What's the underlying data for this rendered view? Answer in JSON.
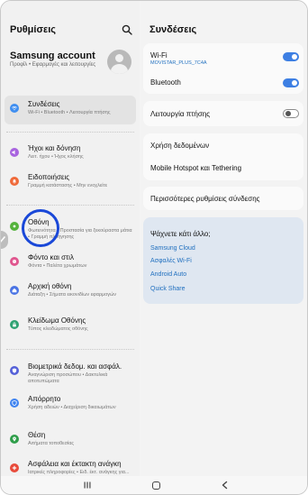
{
  "left_panel": {
    "title": "Ρυθμίσεις",
    "account": {
      "name": "Samsung account",
      "subtitle": "Προφίλ • Εφαρμογές και λειτουργίες"
    },
    "items": [
      {
        "label": "Συνδέσεις",
        "sub": "Wi-Fi • Bluetooth • Λειτουργία πτήσης",
        "icon": "wifi-icon",
        "color": "#3f8ef0"
      },
      {
        "label": "Ήχοι και δόνηση",
        "sub": "Λειτ. ήχου • Ήχος κλήσης",
        "icon": "speaker-icon",
        "color": "#a864df"
      },
      {
        "label": "Ειδοποιήσεις",
        "sub": "Γραμμή κατάστασης • Μην ενοχλείτε",
        "icon": "bell-icon",
        "color": "#ef6a3a"
      },
      {
        "label": "Οθόνη",
        "sub": "Φωτεινότητα • Προστασία για ξεκούραστα μάτια • Γραμμή πλοήγησης",
        "icon": "sun-icon",
        "color": "#55b33d"
      },
      {
        "label": "Φόντο και στιλ",
        "sub": "Φόντα • Παλέτα χρωμάτων",
        "icon": "palette-icon",
        "color": "#e0578f"
      },
      {
        "label": "Αρχική οθόνη",
        "sub": "Διάταξη • Σήματα εικονιδίων εφαρμογών",
        "icon": "home-icon",
        "color": "#4a74e4"
      },
      {
        "label": "Κλείδωμα Οθόνης",
        "sub": "Τύπος κλειδώματος οθόνης",
        "icon": "lock-icon",
        "color": "#2fa272"
      },
      {
        "label": "Βιομετρικά δεδομ. και ασφάλ.",
        "sub": "Αναγνώριση προσώπου • Δακτυλικά αποτυπώματα",
        "icon": "shield-icon",
        "color": "#5561d8"
      },
      {
        "label": "Απόρρητο",
        "sub": "Χρήση αδειών • Διαχείριση δικαιωμάτων",
        "icon": "privacy-icon",
        "color": "#3f83f0"
      },
      {
        "label": "Θέση",
        "sub": "Αιτήματα τοποθεσίας",
        "icon": "location-pin-icon",
        "color": "#2f9e4a"
      },
      {
        "label": "Ασφάλεια και έκτακτη ανάγκη",
        "sub": "Ιατρικές πληροφορίες • Ειδ. έκτ. ανάγκης για...",
        "icon": "emergency-icon",
        "color": "#e84a3a"
      }
    ]
  },
  "right_panel": {
    "title": "Συνδέσεις",
    "wifi": {
      "label": "Wi-Fi",
      "network": "MOVISTAR_PLUS_7C4A"
    },
    "bluetooth": {
      "label": "Bluetooth"
    },
    "airplane": {
      "label": "Λειτουργία πτήσης"
    },
    "data_usage": {
      "label": "Χρήση δεδομένων"
    },
    "hotspot": {
      "label": "Mobile Hotspot και Tethering"
    },
    "more": {
      "label": "Περισσότερες ρυθμίσεις σύνδεσης"
    },
    "suggestions": {
      "title": "Ψάχνετε κάτι άλλο;",
      "links": [
        "Samsung Cloud",
        "Ασφαλές Wi-Fi",
        "Android Auto",
        "Quick Share"
      ]
    }
  },
  "colors": {
    "accent_blue": "#3d7fe3",
    "link_blue": "#1f6fbf",
    "highlight_circle": "#1a48d8"
  }
}
